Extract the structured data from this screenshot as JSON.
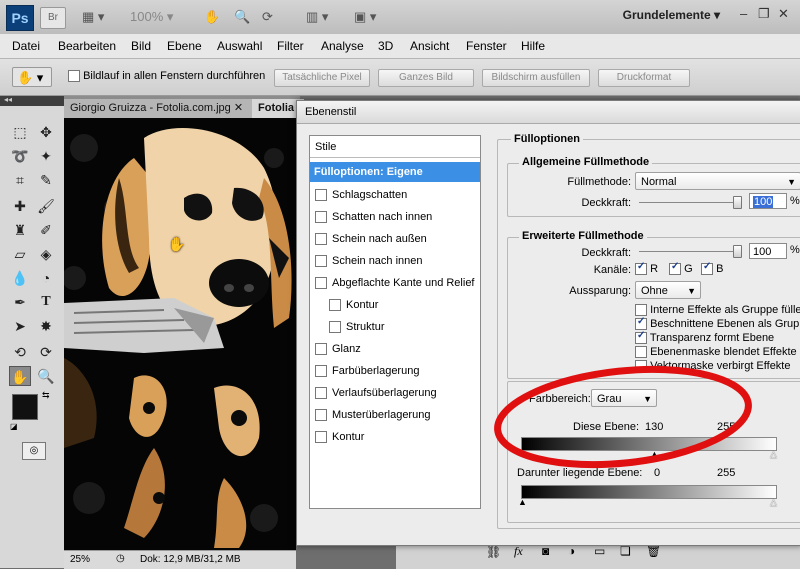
{
  "app": {
    "logo": "Ps",
    "zoom": "100%",
    "workspace": "Grundelemente",
    "icons": [
      "bridge-icon",
      "screen-mode-icon",
      "zoom-level-select",
      "hand-icon",
      "zoom-icon",
      "rotate-view-icon",
      "arrange-icon",
      "screen-layout-icon"
    ]
  },
  "menu": [
    "Datei",
    "Bearbeiten",
    "Bild",
    "Ebene",
    "Auswahl",
    "Filter",
    "Analyse",
    "3D",
    "Ansicht",
    "Fenster",
    "Hilfe"
  ],
  "options": {
    "scroll_all": "Bildlauf in allen Fenstern durchführen",
    "actual_pixels": "Tatsächliche Pixel",
    "fit_screen": "Ganzes Bild",
    "fill_screen": "Bildschirm ausfüllen",
    "print_size": "Druckformat"
  },
  "doc": {
    "tab1": "Giorgio Gruizza - Fotolia.com.jpg",
    "tab2": "Fotolia",
    "zoom": "25%",
    "info": "Dok: 12,9 MB/31,2 MB"
  },
  "dialog": {
    "title": "Ebenenstil",
    "styles_header": "Stile",
    "styles": [
      {
        "label": "Fülloptionen: Eigene",
        "checkbox": false,
        "selected": true
      },
      {
        "label": "Schlagschatten",
        "checkbox": true
      },
      {
        "label": "Schatten nach innen",
        "checkbox": true
      },
      {
        "label": "Schein nach außen",
        "checkbox": true
      },
      {
        "label": "Schein nach innen",
        "checkbox": true
      },
      {
        "label": "Abgeflachte Kante und Relief",
        "checkbox": true
      },
      {
        "label": "Kontur",
        "checkbox": true,
        "indent": true
      },
      {
        "label": "Struktur",
        "checkbox": true,
        "indent": true
      },
      {
        "label": "Glanz",
        "checkbox": true
      },
      {
        "label": "Farbüberlagerung",
        "checkbox": true
      },
      {
        "label": "Verlaufsüberlagerung",
        "checkbox": true
      },
      {
        "label": "Musterüberlagerung",
        "checkbox": true
      },
      {
        "label": "Kontur",
        "checkbox": true
      }
    ],
    "fill_options": "Fülloptionen",
    "general": {
      "title": "Allgemeine Füllmethode",
      "blend_label": "Füllmethode:",
      "blend_value": "Normal",
      "opacity_label": "Deckkraft:",
      "opacity_value": "100",
      "unit": "%"
    },
    "advanced": {
      "title": "Erweiterte Füllmethode",
      "fill_label": "Deckkraft:",
      "fill_value": "100",
      "unit": "%",
      "channels_label": "Kanäle:",
      "channels": [
        "R",
        "G",
        "B"
      ],
      "knockout_label": "Aussparung:",
      "knockout_value": "Ohne",
      "options": [
        {
          "label": "Interne Effekte als Gruppe füllen",
          "checked": false
        },
        {
          "label": "Beschnittene Ebenen als Gruppe f",
          "checked": true
        },
        {
          "label": "Transparenz formt Ebene",
          "checked": true
        },
        {
          "label": "Ebenenmaske blendet Effekte aus",
          "checked": false
        },
        {
          "label": "Vektormaske verbirgt Effekte",
          "checked": false
        }
      ]
    },
    "blendif": {
      "label": "Farbbereich:",
      "value": "Grau",
      "this_layer": "Diese Ebene:",
      "this_low": "130",
      "this_high": "255",
      "under_layer": "Darunter liegende Ebene:",
      "under_low": "0",
      "under_high": "255"
    }
  },
  "colors": {
    "highlight": "#3b8fe4",
    "annotation": "#e01010"
  }
}
